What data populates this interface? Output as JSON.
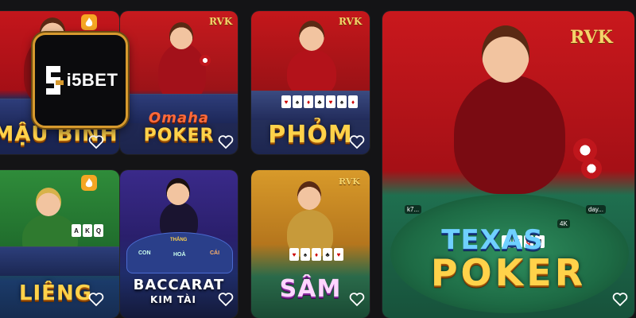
{
  "logo": {
    "text": "i5BET"
  },
  "games": [
    {
      "id": "maubinh",
      "title": "MẬU BINH"
    },
    {
      "id": "omaha",
      "title_top": "Omaha",
      "title_bottom": "POKER"
    },
    {
      "id": "phom",
      "title": "PHỎM"
    },
    {
      "id": "texas",
      "title_top": "TEXAS",
      "title_bottom": "POKER",
      "badge": "RVK",
      "pot": "4K"
    },
    {
      "id": "lieng",
      "title": "LIÊNG"
    },
    {
      "id": "baccarat",
      "title_top": "BACCARAT",
      "title_bottom": "KIM TÀI"
    },
    {
      "id": "sam",
      "title": "SÂM"
    }
  ],
  "baccarat_table": {
    "labels": [
      "CON",
      "HOÀ",
      "CÁI",
      "THẮNG"
    ]
  },
  "icons": {
    "favorite": "heart-outline-icon",
    "hot": "fire-icon"
  },
  "colors": {
    "gold": "#ffd24a",
    "logo_border": "#d79a2e",
    "card_red": "#c4161c"
  }
}
